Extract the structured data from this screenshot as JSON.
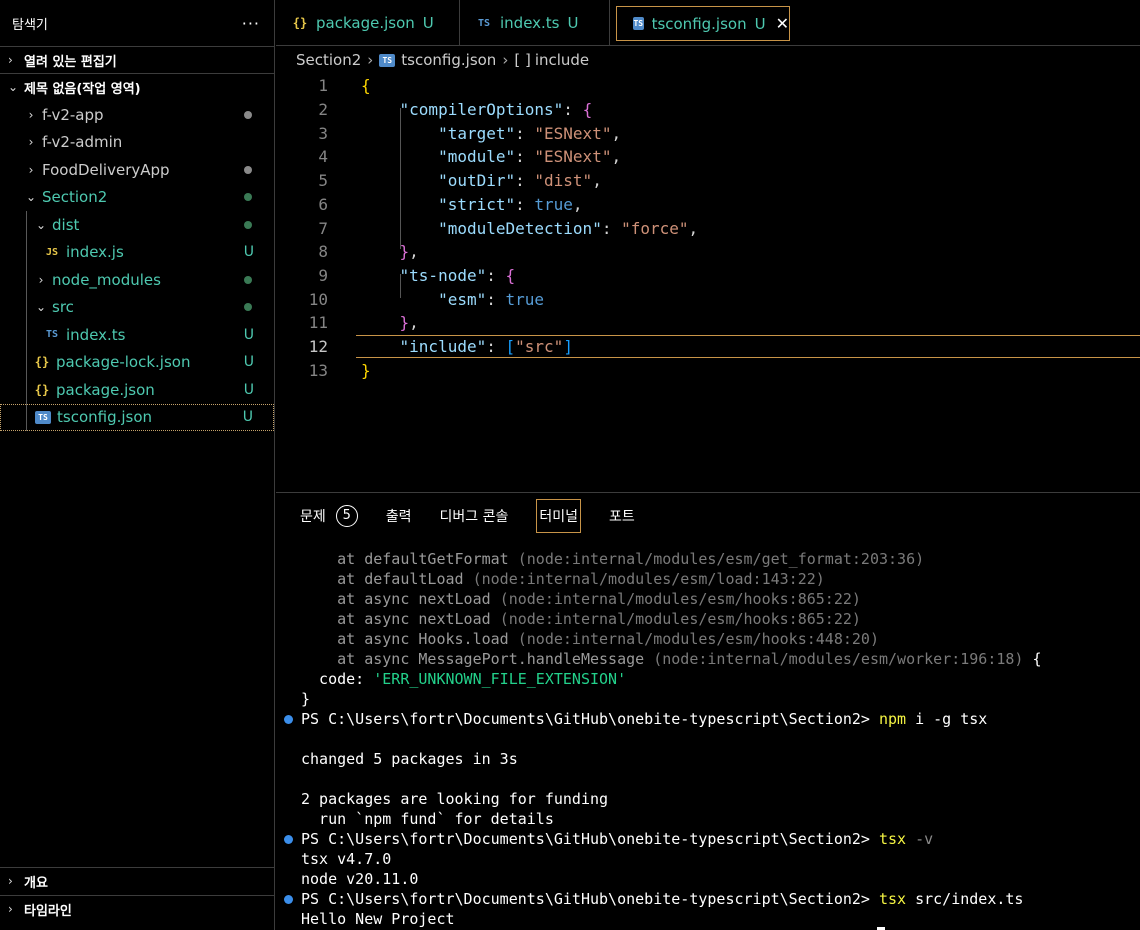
{
  "sidebar": {
    "title": "탐색기",
    "more": "···",
    "open_editors": "열려 있는 편집기",
    "workspace": "제목 없음(작업 영역)",
    "outline": "개요",
    "timeline": "타임라인",
    "tree": [
      {
        "label": "f-v2-app",
        "chev": "›",
        "dot": true
      },
      {
        "label": "f-v2-admin",
        "chev": "›"
      },
      {
        "label": "FoodDeliveryApp",
        "chev": "›",
        "dot": true
      },
      {
        "label": "Section2",
        "chev": "⌄",
        "dot": true,
        "green": true
      },
      {
        "label": "dist",
        "chev": "⌄",
        "dot": true,
        "green": true
      },
      {
        "label": "index.js",
        "icon": "JS",
        "badge": "U"
      },
      {
        "label": "node_modules",
        "chev": "›",
        "dot": true
      },
      {
        "label": "src",
        "chev": "⌄",
        "dot": true
      },
      {
        "label": "index.ts",
        "icon": "TS",
        "badge": "U"
      },
      {
        "label": "package-lock.json",
        "icon": "{}",
        "badge": "U"
      },
      {
        "label": "package.json",
        "icon": "{}",
        "badge": "U"
      },
      {
        "label": "tsconfig.json",
        "icon": "TS",
        "badge": "U"
      }
    ]
  },
  "tabs": [
    {
      "icon": "{}",
      "label": "package.json",
      "status": "U"
    },
    {
      "icon": "TS",
      "label": "index.ts",
      "status": "U"
    },
    {
      "icon": "TS",
      "label": "tsconfig.json",
      "status": "U",
      "close": "✕"
    }
  ],
  "breadcrumb": {
    "folder": "Section2",
    "file": "tsconfig.json",
    "symbol_icon": "[ ]",
    "symbol": "include",
    "sep": "›"
  },
  "editor": {
    "line_numbers": [
      "1",
      "2",
      "3",
      "4",
      "5",
      "6",
      "7",
      "8",
      "9",
      "10",
      "11",
      "12",
      "13"
    ],
    "current_line": 12
  },
  "panel": {
    "tabs": [
      "문제",
      "출력",
      "디버그 콘솔",
      "터미널",
      "포트"
    ],
    "problems_count": "5"
  },
  "terminal": {
    "lines": [
      {
        "text": "    at defaultGetFormat (node:internal/modules/esm/get_format:203:36)",
        "style": "grey"
      },
      {
        "text": "    at defaultLoad (node:internal/modules/esm/load:143:22)",
        "style": "grey"
      },
      {
        "text": "    at async nextLoad (node:internal/modules/esm/hooks:865:22)",
        "style": "grey"
      },
      {
        "text": "    at async nextLoad (node:internal/modules/esm/hooks:865:22)",
        "style": "grey"
      },
      {
        "text": "    at async Hooks.load (node:internal/modules/esm/hooks:448:20)",
        "style": "grey"
      },
      {
        "text": "    at async MessagePort.handleMessage (node:internal/modules/esm/worker:196:18) {",
        "style": "grey"
      },
      {
        "text": "  code: 'ERR_UNKNOWN_FILE_EXTENSION'",
        "style": "code"
      },
      {
        "text": "}",
        "style": "plain"
      },
      {
        "prompt": "PS C:\\Users\\fortr\\Documents\\GitHub\\onebite-typescript\\Section2> ",
        "cmd": "npm",
        "args": " i -g tsx",
        "style": "prompt"
      },
      {
        "text": "",
        "style": "plain"
      },
      {
        "text": "changed 5 packages in 3s",
        "style": "plain"
      },
      {
        "text": "",
        "style": "plain"
      },
      {
        "text": "2 packages are looking for funding",
        "style": "plain"
      },
      {
        "text": "  run `npm fund` for details",
        "style": "plain"
      },
      {
        "prompt": "PS C:\\Users\\fortr\\Documents\\GitHub\\onebite-typescript\\Section2> ",
        "cmd": "tsx",
        "args": " -v",
        "style": "prompt"
      },
      {
        "text": "tsx v4.7.0",
        "style": "plain"
      },
      {
        "text": "node v20.11.0",
        "style": "plain"
      },
      {
        "prompt": "PS C:\\Users\\fortr\\Documents\\GitHub\\onebite-typescript\\Section2> ",
        "cmd": "tsx",
        "args": " src/index.ts",
        "style": "prompt"
      },
      {
        "text": "Hello New Project",
        "style": "plain"
      }
    ]
  }
}
